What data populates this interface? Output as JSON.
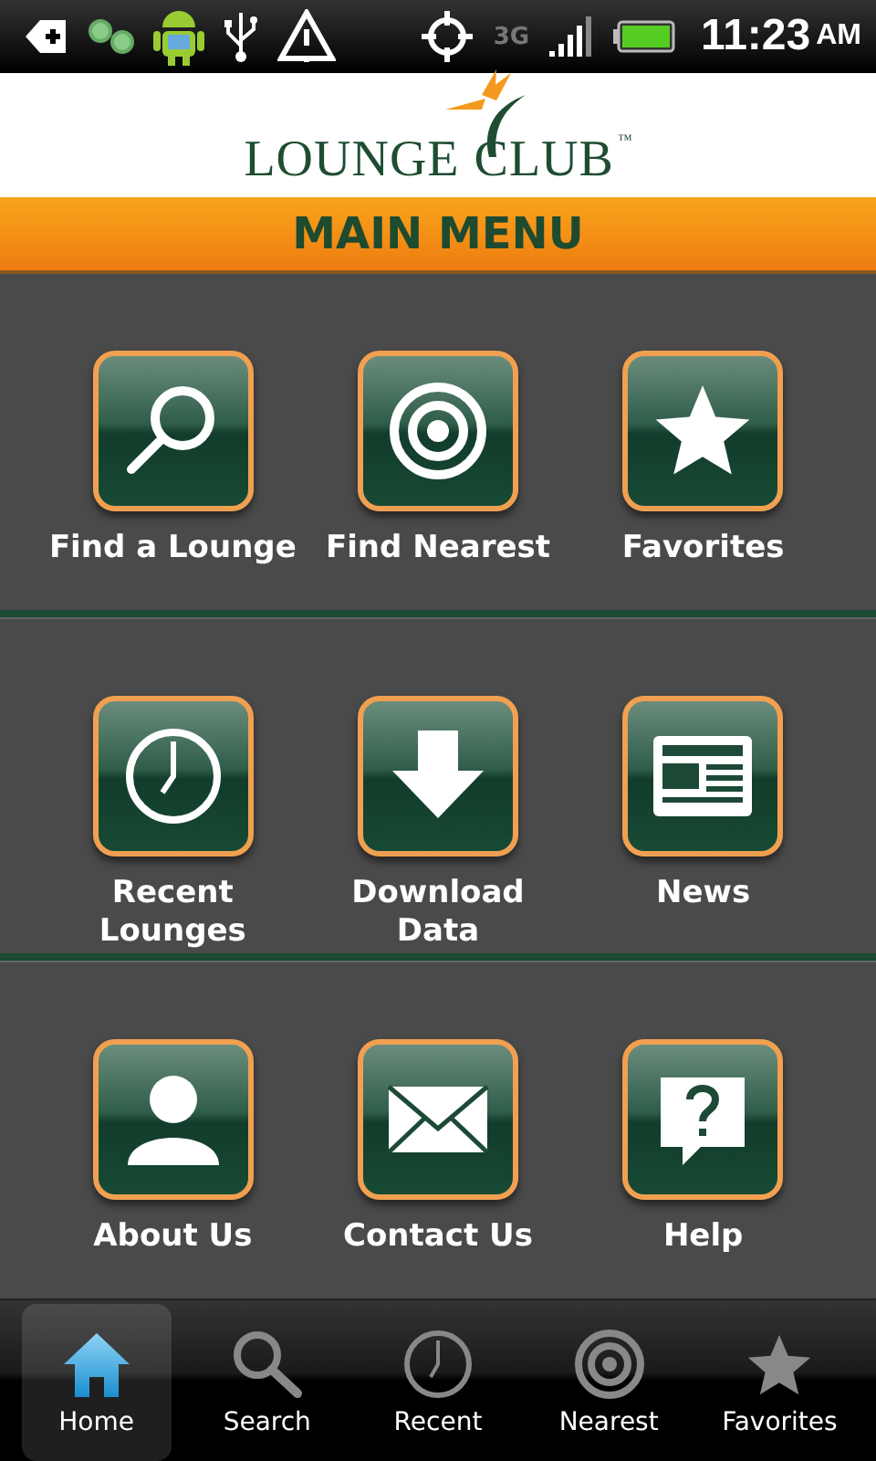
{
  "status_bar": {
    "network": "3G",
    "time": "11:23",
    "ampm": "AM"
  },
  "logo": {
    "word1": "LOUNGE",
    "word2": "CLUB",
    "mark": "™"
  },
  "header": {
    "title": "MAIN MENU"
  },
  "sections": [
    {
      "items": [
        {
          "kind": "search",
          "lines": [
            "Find a Lounge"
          ]
        },
        {
          "kind": "target",
          "lines": [
            "Find Nearest"
          ]
        },
        {
          "kind": "star",
          "lines": [
            "Favorites"
          ]
        }
      ]
    },
    {
      "items": [
        {
          "kind": "clock",
          "lines": [
            "Recent",
            "Lounges"
          ]
        },
        {
          "kind": "download",
          "lines": [
            "Download",
            "Data"
          ]
        },
        {
          "kind": "news",
          "lines": [
            "News"
          ]
        }
      ]
    },
    {
      "items": [
        {
          "kind": "person",
          "lines": [
            "About Us"
          ]
        },
        {
          "kind": "mail",
          "lines": [
            "Contact Us"
          ]
        },
        {
          "kind": "help",
          "lines": [
            "Help"
          ]
        }
      ]
    }
  ],
  "tabs": [
    {
      "kind": "home",
      "label": "Home",
      "selected": true
    },
    {
      "kind": "search",
      "label": "Search",
      "selected": false
    },
    {
      "kind": "clock",
      "label": "Recent",
      "selected": false
    },
    {
      "kind": "target",
      "label": "Nearest",
      "selected": false
    },
    {
      "kind": "star",
      "label": "Favorites",
      "selected": false
    }
  ]
}
